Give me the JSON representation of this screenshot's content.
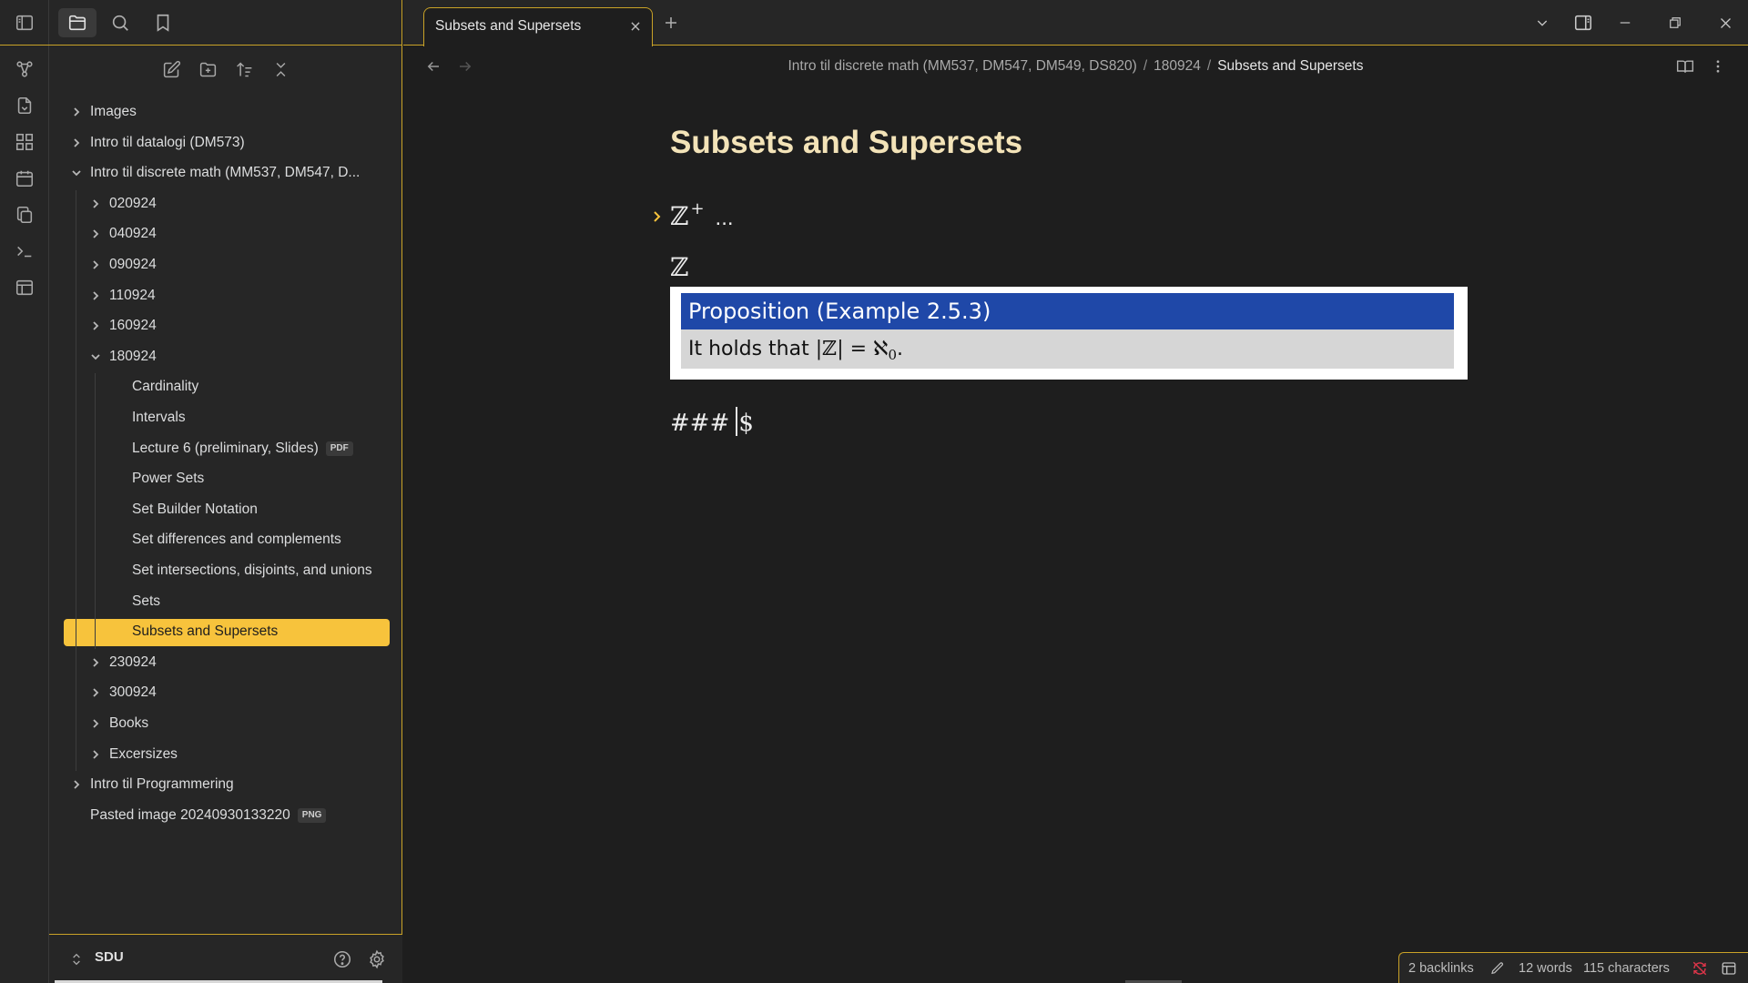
{
  "app": {
    "accent_color": "#c9a227",
    "selected_color": "#f7c33c"
  },
  "ribbon": {
    "icons": [
      "sidebar-toggle-icon",
      "graph-icon",
      "import-icon",
      "canvas-icon",
      "calendar-icon",
      "copy-icon",
      "terminal-icon",
      "table-icon"
    ]
  },
  "sidebar": {
    "tabs": [
      "folder-icon",
      "search-icon",
      "bookmark-icon"
    ],
    "actions": [
      "new-note-icon",
      "new-folder-icon",
      "sort-icon",
      "collapse-all-icon"
    ],
    "tree": [
      {
        "label": "Images",
        "depth": 0,
        "type": "folder",
        "expanded": false
      },
      {
        "label": "Intro til datalogi (DM573)",
        "depth": 0,
        "type": "folder",
        "expanded": false
      },
      {
        "label": "Intro til discrete math (MM537, DM547, D...",
        "depth": 0,
        "type": "folder",
        "expanded": true
      },
      {
        "label": "020924",
        "depth": 1,
        "type": "folder",
        "expanded": false
      },
      {
        "label": "040924",
        "depth": 1,
        "type": "folder",
        "expanded": false
      },
      {
        "label": "090924",
        "depth": 1,
        "type": "folder",
        "expanded": false
      },
      {
        "label": "110924",
        "depth": 1,
        "type": "folder",
        "expanded": false
      },
      {
        "label": "160924",
        "depth": 1,
        "type": "folder",
        "expanded": false
      },
      {
        "label": "180924",
        "depth": 1,
        "type": "folder",
        "expanded": true
      },
      {
        "label": "Cardinality",
        "depth": 2,
        "type": "file"
      },
      {
        "label": "Intervals",
        "depth": 2,
        "type": "file"
      },
      {
        "label": "Lecture 6 (preliminary, Slides)",
        "depth": 2,
        "type": "file",
        "badge": "PDF"
      },
      {
        "label": "Power Sets",
        "depth": 2,
        "type": "file"
      },
      {
        "label": "Set Builder Notation",
        "depth": 2,
        "type": "file"
      },
      {
        "label": "Set differences and complements",
        "depth": 2,
        "type": "file"
      },
      {
        "label": "Set intersections, disjoints, and unions",
        "depth": 2,
        "type": "file"
      },
      {
        "label": "Sets",
        "depth": 2,
        "type": "file"
      },
      {
        "label": "Subsets and Supersets",
        "depth": 2,
        "type": "file",
        "selected": true
      },
      {
        "label": "230924",
        "depth": 1,
        "type": "folder",
        "expanded": false
      },
      {
        "label": "300924",
        "depth": 1,
        "type": "folder",
        "expanded": false
      },
      {
        "label": "Books",
        "depth": 1,
        "type": "folder",
        "expanded": false
      },
      {
        "label": "Excersizes",
        "depth": 1,
        "type": "folder",
        "expanded": false
      },
      {
        "label": "Intro til Programmering",
        "depth": 0,
        "type": "folder",
        "expanded": false
      },
      {
        "label": "Pasted image 20240930133220",
        "depth": 0,
        "type": "file",
        "badge": "PNG"
      }
    ],
    "vault_name": "SDU"
  },
  "tabs": [
    {
      "title": "Subsets and Supersets",
      "active": true
    }
  ],
  "breadcrumb": {
    "parts": [
      "Intro til discrete math (MM537, DM547, DM549, DS820)",
      "180924"
    ],
    "current": "Subsets and Supersets",
    "separator": "/"
  },
  "document": {
    "title": "Subsets and Supersets",
    "heading1_symbol": "ℤ",
    "heading1_sup": "+",
    "heading1_ellipsis": "...",
    "heading2_symbol": "ℤ",
    "embed": {
      "head": "Proposition (Example 2.5.3)",
      "body_text": "It holds that",
      "body_math": "|ℤ| = ℵ",
      "body_sub": "0",
      "body_end": "."
    },
    "raw_line_before": "###",
    "raw_line_after": "$"
  },
  "status": {
    "backlinks": "2 backlinks",
    "words": "12 words",
    "characters": "115 characters"
  }
}
